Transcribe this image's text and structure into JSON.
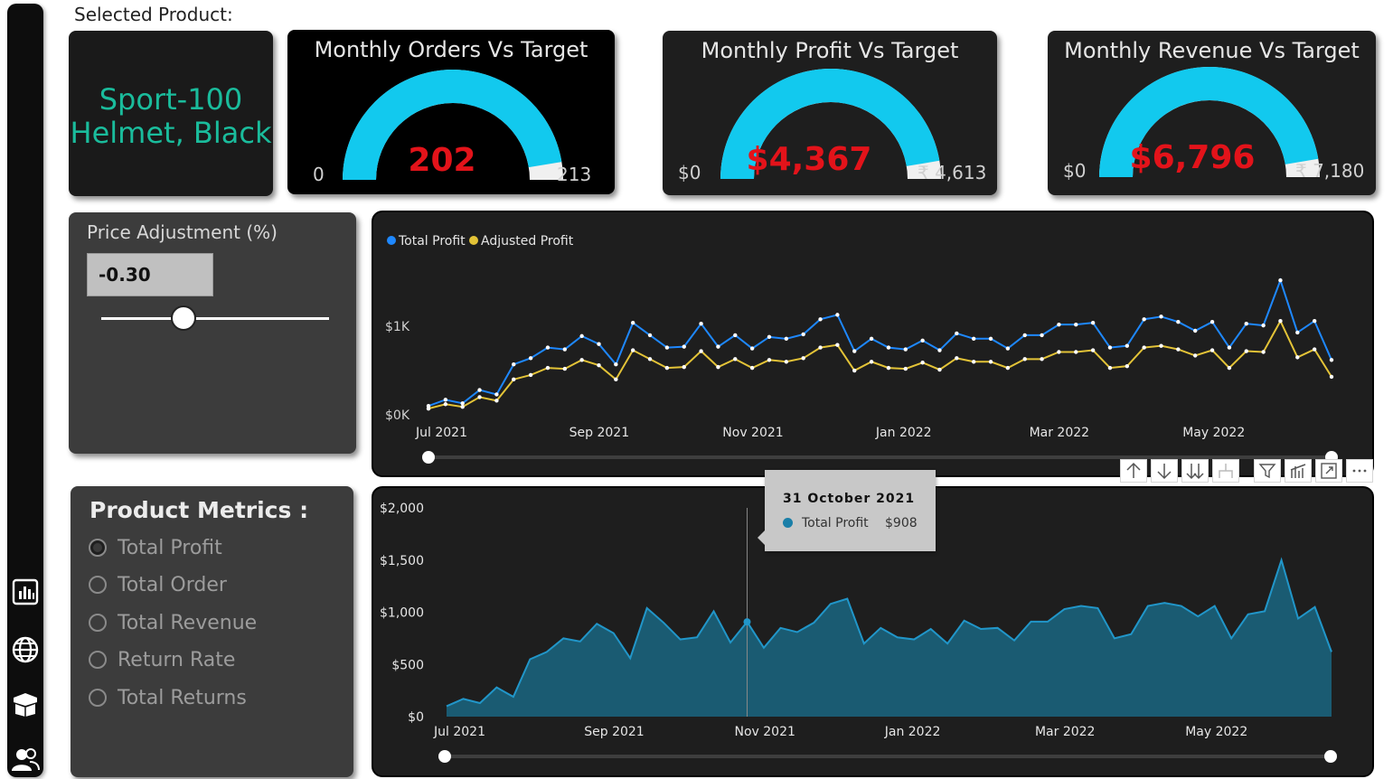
{
  "header": {
    "selected_product_label": "Selected Product:"
  },
  "product": {
    "name_line1": "Sport-100",
    "name_line2": "Helmet, Black"
  },
  "gauges": [
    {
      "title": "Monthly Orders Vs Target",
      "value": "202",
      "min": "0",
      "max": "213",
      "fraction": 0.948
    },
    {
      "title": "Monthly Profit Vs Target",
      "value": "$4,367",
      "min": "$0",
      "max": "₹ 4,613",
      "fraction": 0.947
    },
    {
      "title": "Monthly Revenue Vs Target",
      "value": "$6,796",
      "min": "$0",
      "max": "₹ 7,180",
      "fraction": 0.947
    }
  ],
  "price_adjustment": {
    "label": "Price Adjustment (%)",
    "value": "-0.30",
    "slider_fraction": 0.36
  },
  "metrics": {
    "title": "Product Metrics :",
    "options": [
      "Total Profit",
      "Total Order",
      "Total Revenue",
      "Return Rate",
      "Total Returns"
    ],
    "selected": "Total Profit"
  },
  "colors": {
    "accent_cyan": "#12c9ee",
    "gauge_rest": "#f0f0f0",
    "value_red": "#e3131a",
    "product_teal": "#1abc9c",
    "total_profit_blue": "#1e88ff",
    "adjusted_profit_yellow": "#e3c337",
    "area_fill": "#1a5b72",
    "area_line": "#2196c9"
  },
  "visual_toolbar": {
    "icons": [
      "arrow-up-icon",
      "arrow-down-icon",
      "double-arrow-down-icon",
      "hierarchy-icon",
      "filter-icon",
      "chart-icon",
      "focus-mode-icon",
      "more-options-icon"
    ]
  },
  "tooltip": {
    "date": "31 October 2021",
    "series": "Total Profit",
    "value": "$908"
  },
  "sidebar": {
    "icons": [
      "bar-chart-icon",
      "globe-icon",
      "box-icon",
      "users-icon"
    ]
  },
  "chart_data": [
    {
      "type": "line",
      "title": "",
      "legend_position": "top-left",
      "x_tick_labels": [
        "Jul 2021",
        "Sep 2021",
        "Nov 2021",
        "Jan 2022",
        "Mar 2022",
        "May 2022"
      ],
      "y_tick_labels": [
        "$0K",
        "$1K"
      ],
      "ylim": [
        0,
        1900
      ],
      "series": [
        {
          "name": "Total Profit",
          "values": [
            100,
            170,
            130,
            280,
            230,
            570,
            640,
            760,
            740,
            890,
            800,
            570,
            1040,
            900,
            760,
            770,
            1030,
            770,
            900,
            750,
            880,
            860,
            910,
            1080,
            1130,
            720,
            860,
            760,
            740,
            840,
            730,
            920,
            860,
            860,
            750,
            900,
            900,
            1020,
            1020,
            1040,
            760,
            780,
            1080,
            1110,
            1050,
            950,
            1050,
            760,
            1030,
            1010,
            1520,
            930,
            1060,
            620
          ]
        },
        {
          "name": "Adjusted Profit",
          "values": [
            70,
            120,
            90,
            200,
            160,
            400,
            450,
            530,
            520,
            620,
            560,
            400,
            730,
            630,
            530,
            540,
            720,
            540,
            630,
            530,
            620,
            600,
            640,
            760,
            790,
            500,
            600,
            530,
            520,
            590,
            510,
            640,
            600,
            600,
            530,
            630,
            630,
            710,
            710,
            730,
            530,
            550,
            760,
            780,
            740,
            670,
            730,
            530,
            720,
            710,
            1060,
            650,
            740,
            430
          ]
        }
      ]
    },
    {
      "type": "area",
      "title": "",
      "x_tick_labels": [
        "Jul 2021",
        "Sep 2021",
        "Nov 2021",
        "Jan 2022",
        "Mar 2022",
        "May 2022"
      ],
      "y_tick_labels": [
        "$0",
        "$500",
        "$1,000",
        "$1,500",
        "$2,000"
      ],
      "ylim": [
        0,
        2000
      ],
      "series": [
        {
          "name": "Total Profit",
          "values": [
            100,
            170,
            130,
            280,
            190,
            550,
            620,
            750,
            720,
            890,
            800,
            560,
            1040,
            900,
            740,
            760,
            1010,
            710,
            908,
            660,
            850,
            810,
            900,
            1080,
            1130,
            700,
            850,
            760,
            740,
            840,
            700,
            920,
            840,
            850,
            730,
            910,
            910,
            1030,
            1060,
            1040,
            750,
            790,
            1060,
            1090,
            1060,
            960,
            1060,
            750,
            980,
            1010,
            1500,
            940,
            1050,
            620
          ]
        }
      ],
      "highlighted_index": 18
    }
  ]
}
